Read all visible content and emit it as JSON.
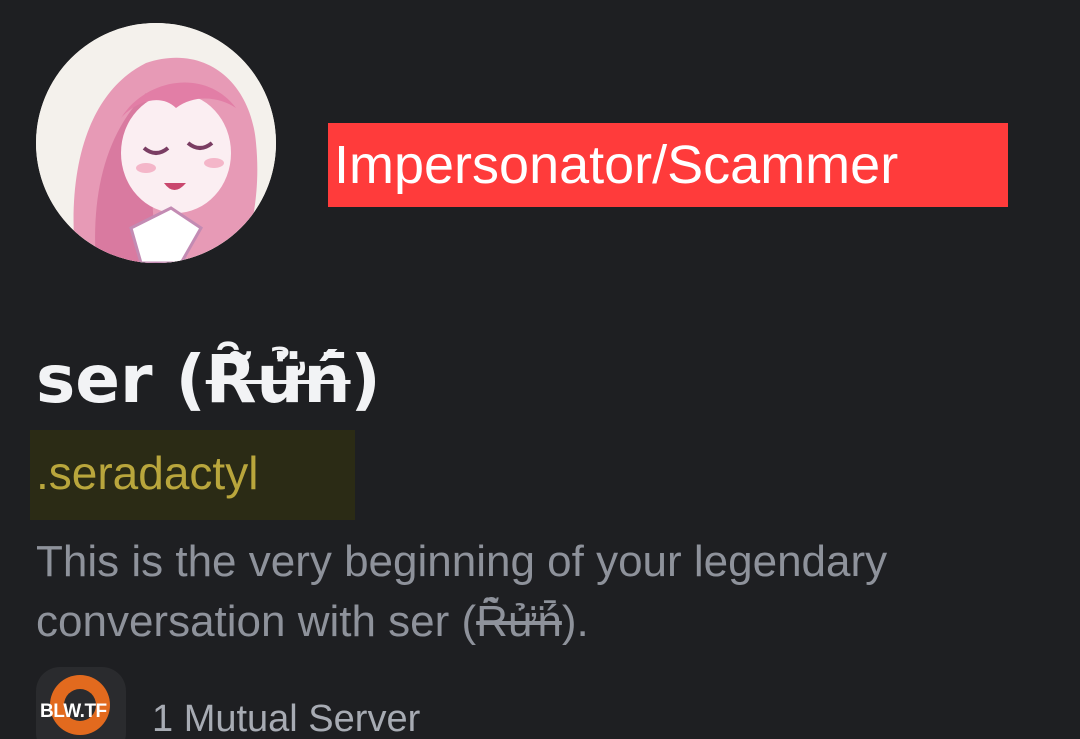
{
  "profile": {
    "avatar_icon": "anime-girl-avatar",
    "flag_label": "Impersonator/Scammer",
    "flag_color": "#ff3b3b",
    "display_name_prefix": "ser (",
    "display_name_styled": "Ȓ̃ử̈ń̄",
    "display_name_suffix": ")",
    "username": ".seradactyl",
    "username_color": "#b9a63c"
  },
  "intro": {
    "text_before": "This is the very beginning of your legendary conversation with ser (",
    "styled_name": "Ȓ̃ử̈ń̄",
    "text_after": ")."
  },
  "mutual": {
    "server_icon_label": "BLW.TF",
    "label": "1 Mutual Server"
  }
}
